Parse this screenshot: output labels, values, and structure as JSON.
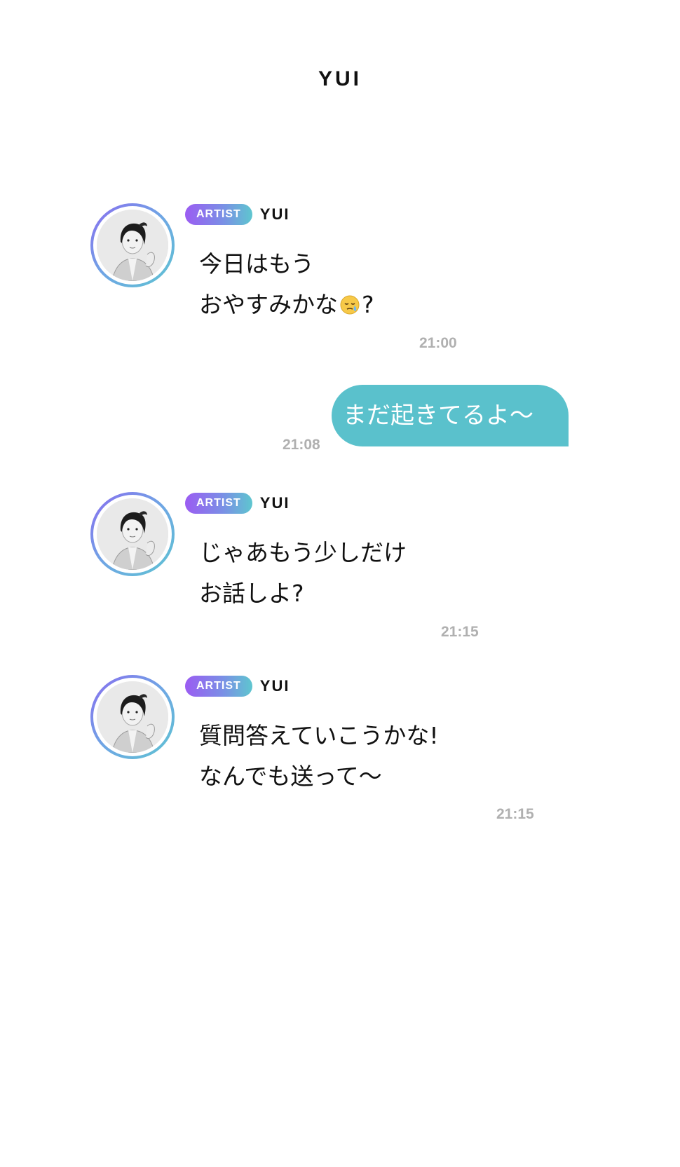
{
  "header": {
    "title": "YUI"
  },
  "messages": [
    {
      "from": "artist",
      "badge": "ARTIST",
      "sender": "YUI",
      "lines": [
        "今日はもう",
        "おやすみかな",
        "?"
      ],
      "emoji": "sleepy-face-icon",
      "time": "21:00"
    },
    {
      "from": "user",
      "text": "まだ起きてるよ〜",
      "time": "21:08"
    },
    {
      "from": "artist",
      "badge": "ARTIST",
      "sender": "YUI",
      "lines": [
        "じゃあもう少しだけ",
        "お話しよ?"
      ],
      "time": "21:15"
    },
    {
      "from": "artist",
      "badge": "ARTIST",
      "sender": "YUI",
      "lines": [
        "質問答えていこうかな!",
        "なんでも送って〜"
      ],
      "time": "21:15"
    }
  ],
  "colors": {
    "user_bubble": "#5ac1cc",
    "badge_gradient_start": "#9b5cf2",
    "badge_gradient_end": "#5ec6cf",
    "timestamp": "#b0b0b0"
  }
}
